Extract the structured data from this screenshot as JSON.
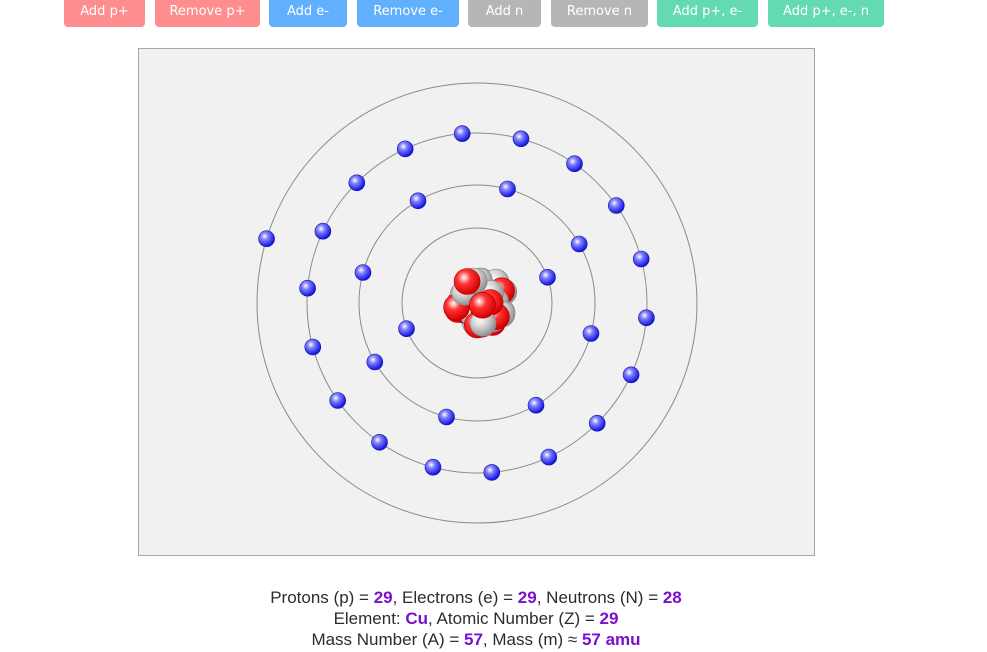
{
  "buttons": {
    "add_proton": "Add p+",
    "remove_proton": "Remove p+",
    "add_electron": "Add e-",
    "remove_electron": "Remove e-",
    "add_neutron": "Add n",
    "remove_neutron": "Remove n",
    "add_proton_electron": "Add p+, e-",
    "add_proton_electron_neutron": "Add p+, e-, n"
  },
  "colors": {
    "proton": "#ff1a1a",
    "neutron": "#bdbdbd",
    "electron": "#2a2aff",
    "value_highlight": "#7a0fd1"
  },
  "atom": {
    "protons": 29,
    "electrons": 29,
    "neutrons": 28,
    "shells": [
      2,
      8,
      18,
      1
    ]
  },
  "info": {
    "protons_label": "Protons (p) = ",
    "protons_value": "29",
    "electrons_label": ", Electrons (e) = ",
    "electrons_value": "29",
    "neutrons_label": ", Neutrons (N) = ",
    "neutrons_value": "28",
    "element_label": "Element: ",
    "element_value": "Cu",
    "atomic_number_label": ", Atomic Number (Z) = ",
    "atomic_number_value": "29",
    "mass_number_label": "Mass Number (A) = ",
    "mass_number_value": "57",
    "mass_label": ", Mass (m) ≈ ",
    "mass_value": "57 amu"
  }
}
